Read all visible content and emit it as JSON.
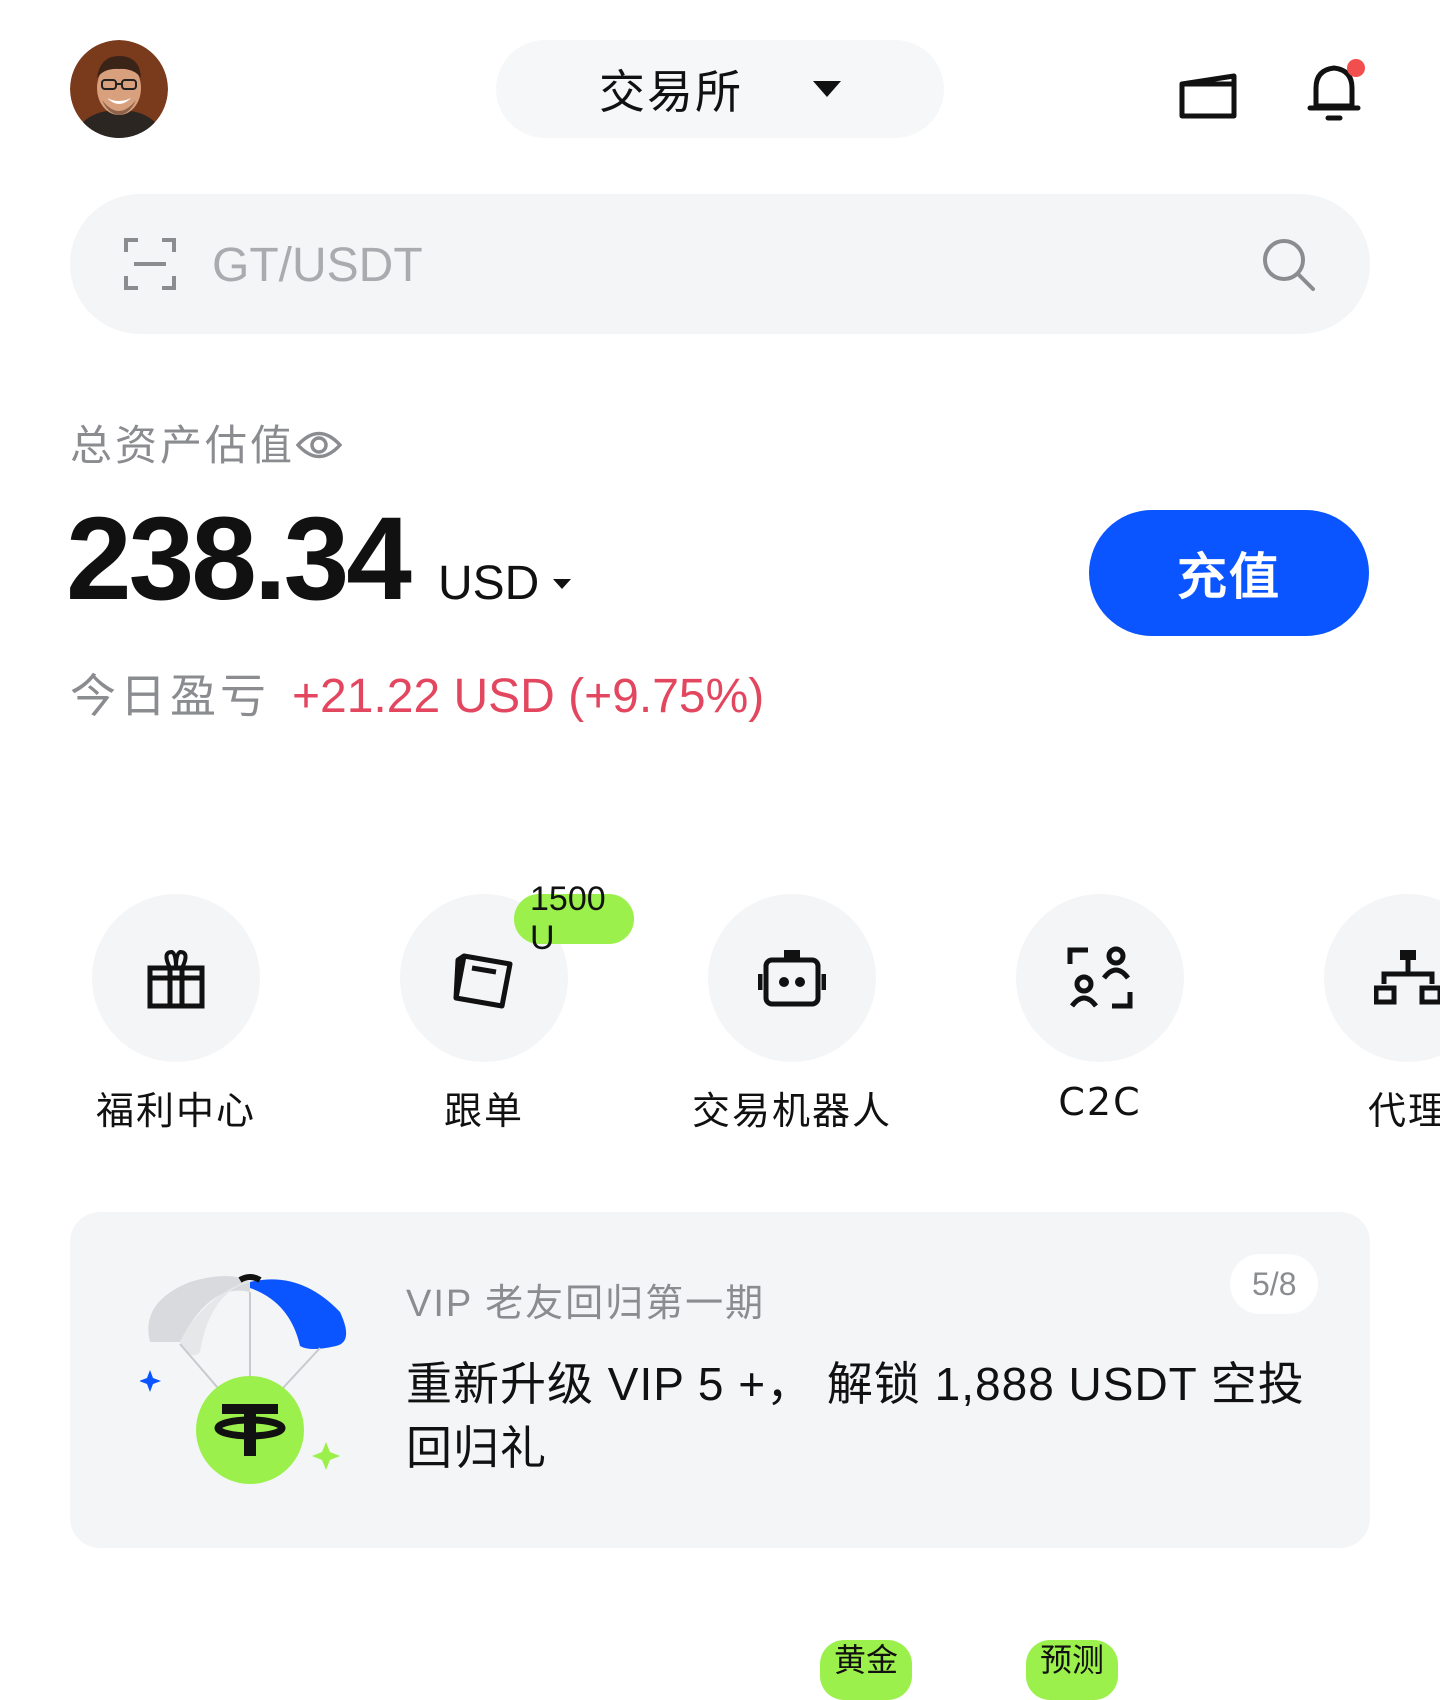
{
  "header": {
    "avatar_icon": "user-avatar",
    "mode_label": "交易所",
    "wallet_icon": "wallet-icon",
    "bell_icon": "bell-icon",
    "notification_dot_color": "#f24e4e"
  },
  "search": {
    "placeholder": "GT/USDT",
    "scan_icon": "scan-icon",
    "search_icon": "search-icon"
  },
  "assets": {
    "label": "总资产估值",
    "value": "238.34",
    "currency": "USD",
    "deposit_label": "充值",
    "pnl_label": "今日盈亏",
    "pnl_value": "+21.22 USD (+9.75%)",
    "pnl_color": "#e3475f",
    "accent_color": "#0a55ff"
  },
  "quick_actions": [
    {
      "label": "福利中心",
      "icon": "gift-icon"
    },
    {
      "label": "跟单",
      "icon": "copy-trade-icon",
      "badge": "1500 U"
    },
    {
      "label": "交易机器人",
      "icon": "robot-icon"
    },
    {
      "label": "C2C",
      "icon": "c2c-icon"
    },
    {
      "label": "代理",
      "icon": "agent-icon"
    }
  ],
  "promo": {
    "kicker": "VIP 老友回归第一期",
    "counter": "5/8",
    "title": "重新升级 VIP 5 +， 解锁 1,888 USDT 空投回归礼",
    "illustration_icon": "tether-parachute-icon"
  },
  "bottom_tags": [
    "黄金",
    "预测"
  ]
}
